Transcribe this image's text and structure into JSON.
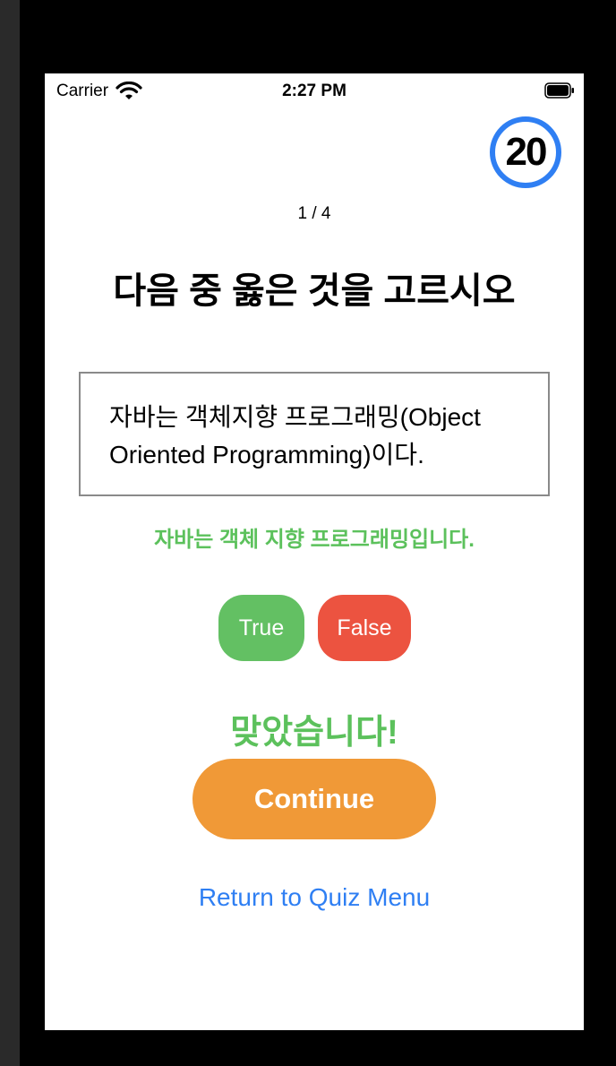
{
  "status_bar": {
    "carrier": "Carrier",
    "time": "2:27 PM"
  },
  "timer": {
    "value": "20"
  },
  "progress": {
    "text": "1 / 4"
  },
  "question": {
    "title": "다음 중 옳은 것을 고르시오",
    "statement_line1": "자바는 객체지향 프로그래밍(Object",
    "statement_line2": "Oriented Programming)이다."
  },
  "explanation": "자바는 객체 지향 프로그래밍입니다.",
  "answers": {
    "true_label": "True",
    "false_label": "False"
  },
  "result": "맞았습니다!",
  "actions": {
    "continue_label": "Continue",
    "return_label": "Return to Quiz Menu"
  },
  "colors": {
    "timer_ring": "#2f7ff3",
    "correct_green": "#5cc15c",
    "true_button": "#63c063",
    "false_button": "#ec5340",
    "continue_orange": "#f09937",
    "link_blue": "#2f7ff3"
  },
  "icons": [
    "wifi-icon",
    "battery-icon"
  ]
}
